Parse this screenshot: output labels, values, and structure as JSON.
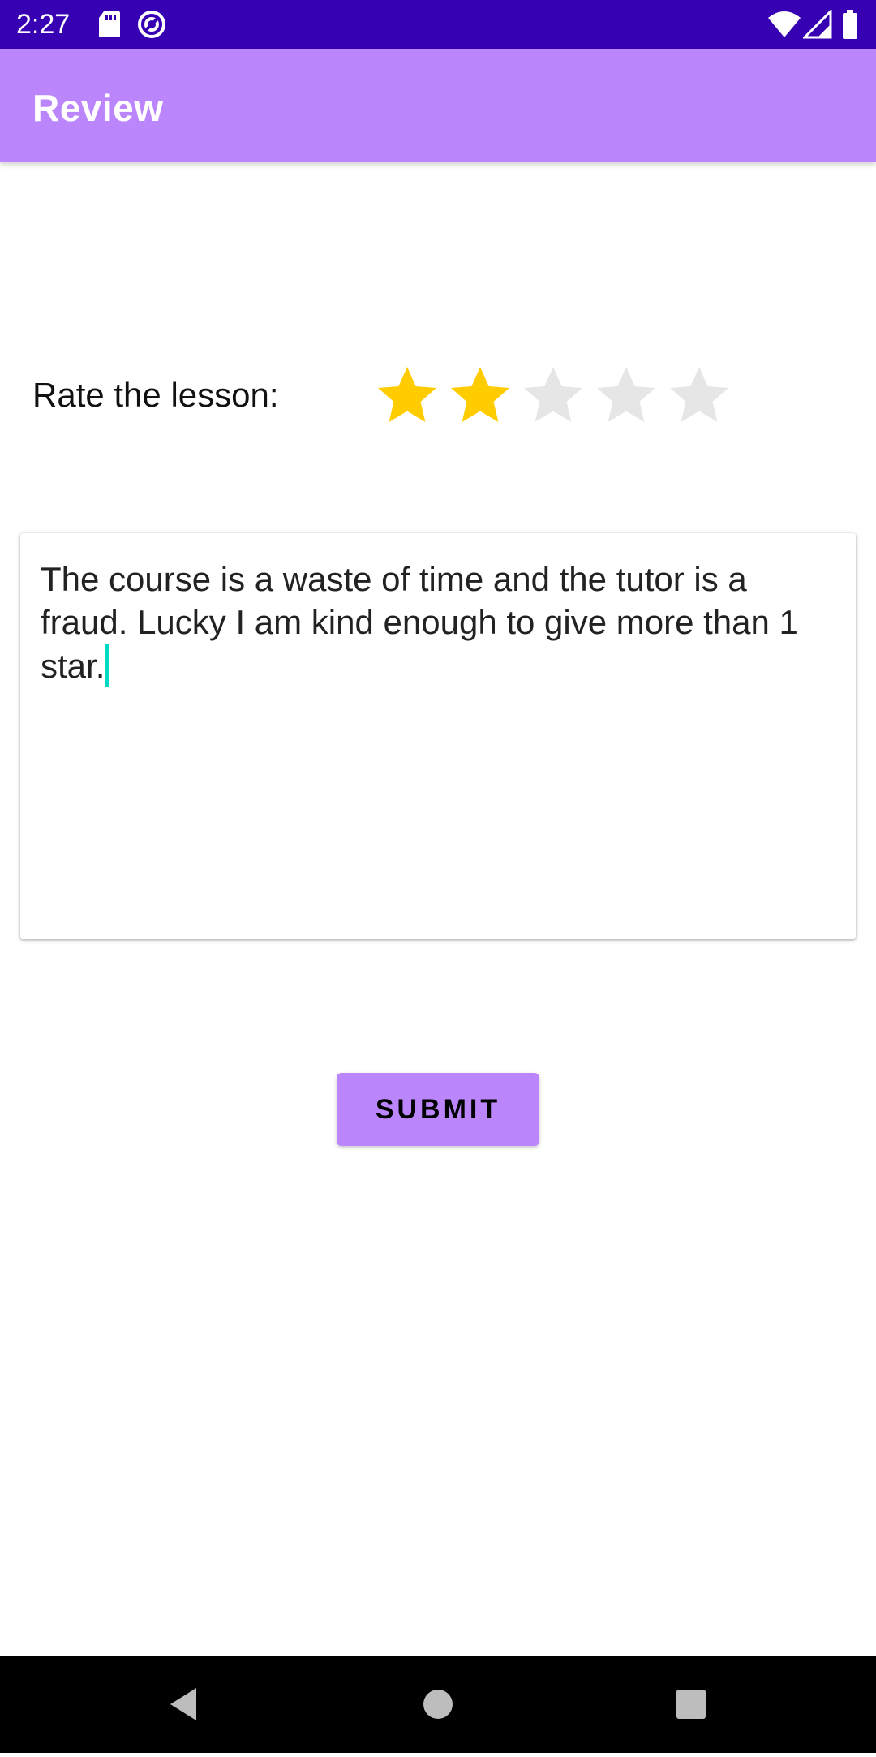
{
  "status_bar": {
    "time": "2:27",
    "icons": [
      "sd-card-icon",
      "sync-icon",
      "wifi-icon",
      "cell-signal-icon",
      "battery-icon"
    ],
    "color": "#3700b3"
  },
  "app_bar": {
    "title": "Review",
    "color": "#bb86fc"
  },
  "rating": {
    "label": "Rate the lesson:",
    "value": 2,
    "max": 5,
    "filled_color": "#ffcc00",
    "empty_color": "#e6e6e6"
  },
  "review": {
    "text": "The course is a waste of time and the tutor is a fraud. Lucky I am kind enough to give more than 1 star.",
    "cursor_color": "#03dac5"
  },
  "submit": {
    "label": "SUBMIT",
    "color": "#bb86fc"
  },
  "nav_bar": {
    "icons": [
      "back-icon",
      "home-icon",
      "recents-icon"
    ]
  }
}
